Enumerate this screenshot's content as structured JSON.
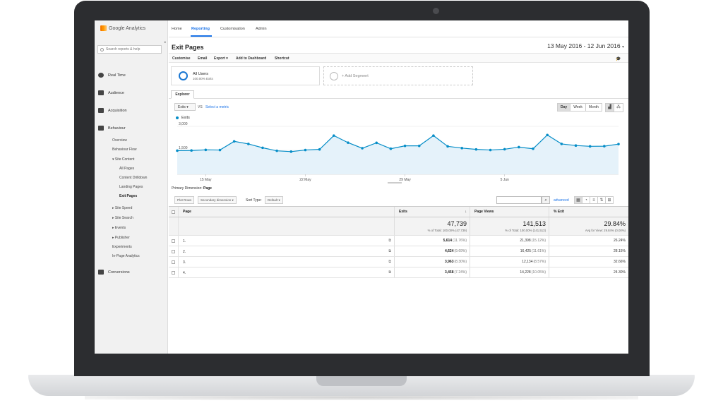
{
  "app": {
    "name": "Google Analytics"
  },
  "top_nav": [
    "Home",
    "Reporting",
    "Customisation",
    "Admin"
  ],
  "sidebar": {
    "search_placeholder": "Search reports & help",
    "sections": [
      {
        "label": "Real Time",
        "icon": "clock-icon"
      },
      {
        "label": "Audience",
        "icon": "people-icon"
      },
      {
        "label": "Acquisition",
        "icon": "acquisition-icon"
      },
      {
        "label": "Behaviour",
        "icon": "behaviour-icon"
      }
    ],
    "behaviour_items": [
      "Overview",
      "Behaviour Flow",
      "▾ Site Content",
      "All Pages",
      "Content Drilldown",
      "Landing Pages",
      "Exit Pages",
      "▸ Site Speed",
      "▸ Site Search",
      "▸ Events",
      "▸ Publisher",
      "Experiments",
      "In-Page Analytics"
    ],
    "conversions": "Conversions"
  },
  "report": {
    "title": "Exit Pages",
    "date_range": "13 May 2016 - 12 Jun 2016",
    "actions": [
      "Customise",
      "Email",
      "Export ▾",
      "Add to Dashboard",
      "Shortcut"
    ],
    "segment": {
      "name": "All Users",
      "sub": "100.00% Exits"
    },
    "add_segment": "+ Add Segment",
    "tab": "Explorer",
    "metric": "Exits",
    "vs": "VS",
    "select_metric": "Select a metric",
    "periods": [
      "Day",
      "Week",
      "Month"
    ],
    "active_period": "Day",
    "legend": "Exits"
  },
  "chart_data": {
    "type": "line",
    "series": [
      {
        "name": "Exits",
        "values": [
          1480,
          1490,
          1530,
          1520,
          2060,
          1900,
          1660,
          1470,
          1420,
          1520,
          1560,
          2420,
          1980,
          1630,
          1970,
          1600,
          1780,
          1780,
          2420,
          1750,
          1640,
          1560,
          1520,
          1570,
          1700,
          1600,
          2460,
          1900,
          1800,
          1750,
          1760,
          1890
        ]
      }
    ],
    "ylim": [
      0,
      3000
    ],
    "yticks": [
      "3,000",
      "1,500"
    ],
    "xticks": [
      "15 May",
      "22 May",
      "29 May",
      "5 Jun"
    ],
    "color": "#058dc7",
    "fill": "#e5f2fa"
  },
  "controls": {
    "plot_rows": "Plot Rows",
    "primary_dimension_label": "Primary Dimension:",
    "primary_dimension": "Page",
    "secondary_dimension": "Secondary dimension ▾",
    "sort_type_label": "Sort Type:",
    "sort_type": "Default ▾",
    "advanced": "advanced"
  },
  "table": {
    "headers": {
      "page": "Page",
      "exits": "Exits",
      "views": "Page Views",
      "pct": "% Exit"
    },
    "totals": {
      "exits": "47,739",
      "exits_sub": "% of Total: 100.00% (47,739)",
      "views": "141,513",
      "views_sub": "% of Total: 100.00% (141,513)",
      "pct": "29.84%",
      "pct_sub": "Avg for View: 29.84% (0.00%)"
    },
    "rows": [
      {
        "num": "1.",
        "exits": "5,614",
        "exits_pct": "(11.76%)",
        "views": "21,398",
        "views_pct": "(15.12%)",
        "pct": "26.24%"
      },
      {
        "num": "2.",
        "exits": "4,624",
        "exits_pct": "(9.69%)",
        "views": "16,425",
        "views_pct": "(11.61%)",
        "pct": "28.15%"
      },
      {
        "num": "3.",
        "exits": "3,963",
        "exits_pct": "(8.30%)",
        "views": "12,134",
        "views_pct": "(8.57%)",
        "pct": "32.66%"
      },
      {
        "num": "4.",
        "exits": "3,458",
        "exits_pct": "(7.24%)",
        "views": "14,228",
        "views_pct": "(10.05%)",
        "pct": "24.30%"
      }
    ]
  }
}
